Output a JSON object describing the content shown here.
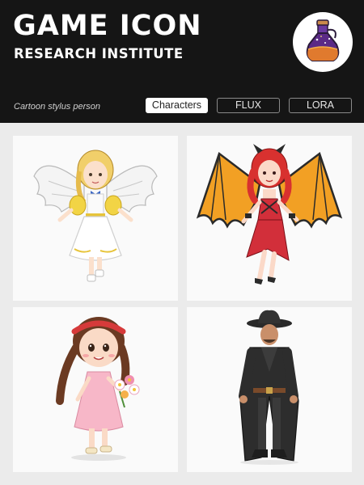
{
  "header": {
    "title": "GAME ICON",
    "subtitle": "RESEARCH INSTITUTE",
    "tagline": "Cartoon stylus person"
  },
  "tags": [
    {
      "label": "Characters",
      "active": true
    },
    {
      "label": "FLUX",
      "active": false
    },
    {
      "label": "LORA",
      "active": false
    }
  ],
  "colors": {
    "header_bg": "#151515",
    "page_bg": "#ebebeb",
    "card_bg": "#fafafa",
    "accent_purple": "#5b2a86"
  },
  "icons": {
    "logo": "potion-bottle-icon"
  },
  "gallery": [
    {
      "subject": "angel-girl"
    },
    {
      "subject": "devil-girl"
    },
    {
      "subject": "flower-girl"
    },
    {
      "subject": "cowboy"
    }
  ]
}
